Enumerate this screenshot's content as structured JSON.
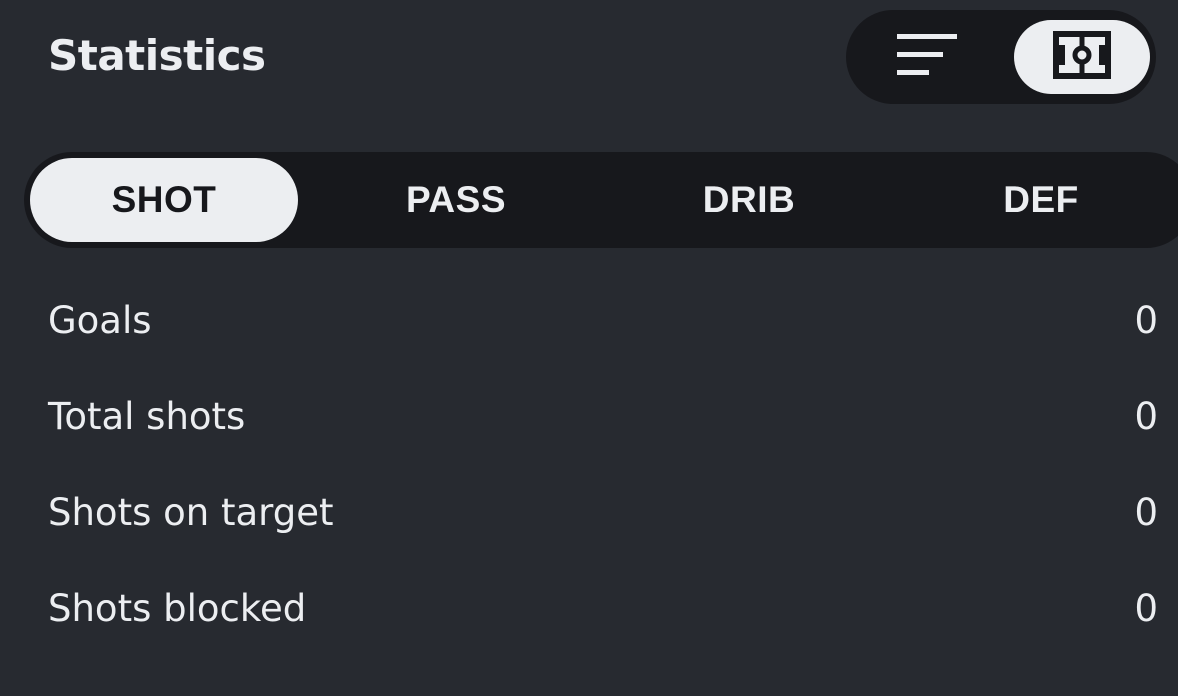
{
  "header": {
    "title": "Statistics"
  },
  "view_toggle": {
    "options": [
      {
        "icon": "list-icon",
        "selected": false
      },
      {
        "icon": "pitch-icon",
        "selected": true
      }
    ]
  },
  "tabs": [
    {
      "label": "SHOT",
      "selected": true
    },
    {
      "label": "PASS",
      "selected": false
    },
    {
      "label": "DRIB",
      "selected": false
    },
    {
      "label": "DEF",
      "selected": false
    }
  ],
  "stats": [
    {
      "label": "Goals",
      "value": "0"
    },
    {
      "label": "Total shots",
      "value": "0"
    },
    {
      "label": "Shots on target",
      "value": "0"
    },
    {
      "label": "Shots blocked",
      "value": "0"
    }
  ],
  "colors": {
    "background": "#272a30",
    "surface_dark": "#17181c",
    "selected_pill": "#eceef1",
    "text": "#eceef1"
  }
}
